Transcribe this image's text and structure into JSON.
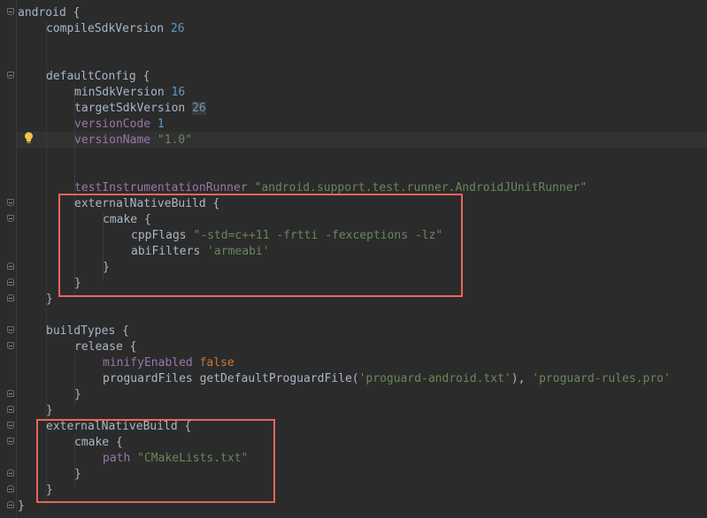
{
  "lines": {
    "l1": "android {",
    "l2_key": "compileSdkVersion",
    "l2_val": "26",
    "l5": "defaultConfig {",
    "l6_key": "minSdkVersion",
    "l6_val": "16",
    "l7_key": "targetSdkVersion",
    "l7_val": "26",
    "l8_key": "versionCode",
    "l8_val": "1",
    "l9_key": "versionName",
    "l9_val": "\"1.0\"",
    "l12_key": "testInstrumentationRunner",
    "l12_val": "\"android.support.test.runner.AndroidJUnitRunner\"",
    "l13": "externalNativeBuild {",
    "l14": "cmake {",
    "l15_key": "cppFlags",
    "l15_val": "\"-std=c++11 -frtti -fexceptions -lz\"",
    "l16_key": "abiFilters",
    "l16_val": "'armeabi'",
    "l17": "}",
    "l18": "}",
    "l19": "}",
    "l21": "buildTypes {",
    "l22": "release {",
    "l23_key": "minifyEnabled",
    "l23_val": "false",
    "l24_key": "proguardFiles",
    "l24_fn": "getDefaultProguardFile(",
    "l24_s1": "'proguard-android.txt'",
    "l24_mid": "), ",
    "l24_s2": "'proguard-rules.pro'",
    "l25": "}",
    "l26": "}",
    "l27": "externalNativeBuild {",
    "l28": "cmake {",
    "l29_key": "path",
    "l29_val": "\"CMakeLists.txt\"",
    "l30": "}",
    "l31": "}",
    "l32": "}"
  },
  "colors": {
    "background": "#2b2b2b",
    "text": "#a9b7c6",
    "property": "#9876aa",
    "number": "#6897bb",
    "string": "#6a8759",
    "keyword": "#cc7832",
    "highlight_box": "#e8665a"
  },
  "icons": {
    "bulb": "lightbulb-icon",
    "fold": "fold-marker-icon"
  }
}
